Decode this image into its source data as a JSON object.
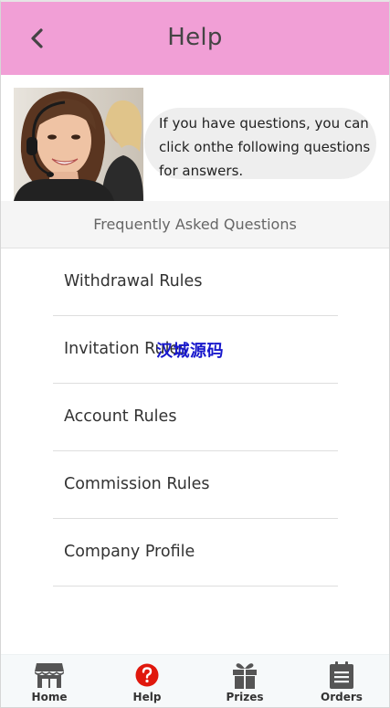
{
  "header": {
    "title": "Help",
    "back_icon": "chevron-left-icon",
    "background": "#f19fd6"
  },
  "banner": {
    "photo": "customer-service-agent-photo",
    "message": "If you have questions, you can click onthe following questions for answers."
  },
  "faq": {
    "title": "Frequently Asked Questions",
    "items": [
      {
        "label": "Withdrawal Rules"
      },
      {
        "label": "Invitation Rules"
      },
      {
        "label": "Account Rules"
      },
      {
        "label": "Commission Rules"
      },
      {
        "label": "Company Profile"
      }
    ]
  },
  "watermark": "汉城源码",
  "tabbar": {
    "active_color": "#e0180d",
    "tabs": [
      {
        "label": "Home",
        "icon": "store-icon"
      },
      {
        "label": "Help",
        "icon": "help-question-icon",
        "active": true
      },
      {
        "label": "Prizes",
        "icon": "gift-icon"
      },
      {
        "label": "Orders",
        "icon": "clipboard-list-icon"
      }
    ]
  }
}
